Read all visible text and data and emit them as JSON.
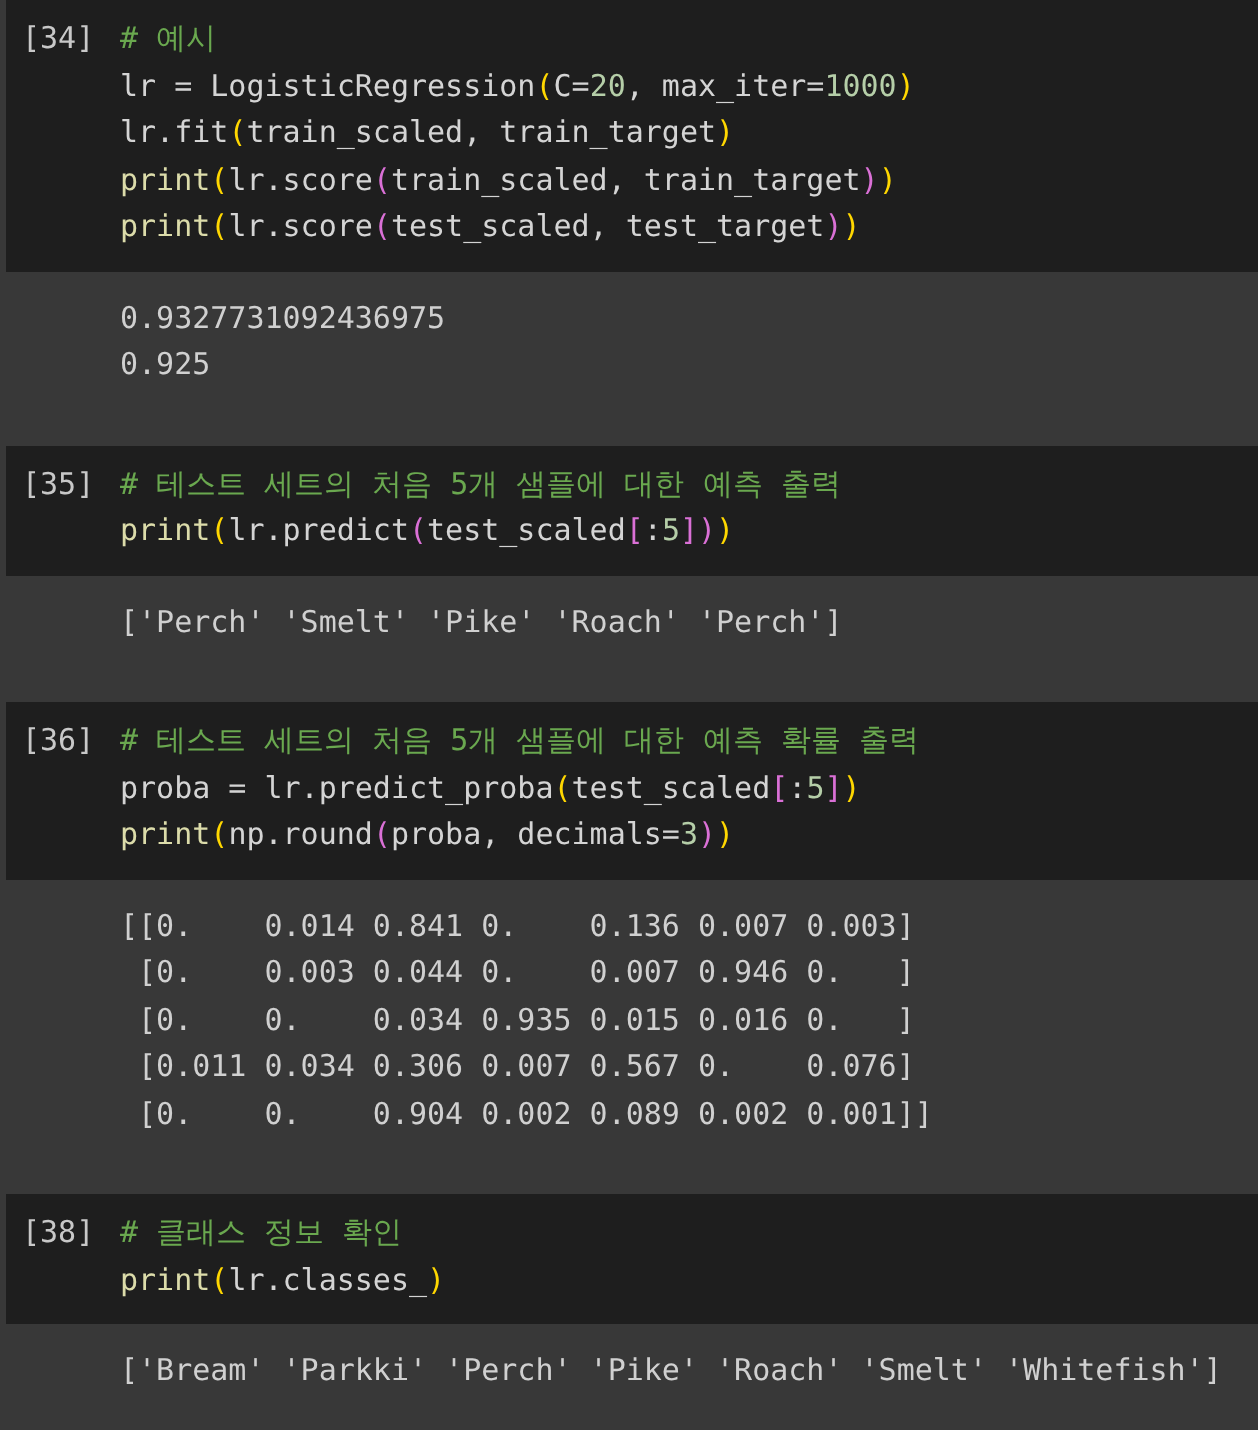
{
  "cells": [
    {
      "prompt": "[34]",
      "code": [
        [
          {
            "kind": "comment",
            "text": "# 예시"
          }
        ],
        [
          {
            "kind": "plain",
            "text": "lr = LogisticRegression"
          },
          {
            "kind": "paren1",
            "text": "("
          },
          {
            "kind": "plain",
            "text": "C="
          },
          {
            "kind": "number",
            "text": "20"
          },
          {
            "kind": "plain",
            "text": ", max_iter="
          },
          {
            "kind": "number",
            "text": "1000"
          },
          {
            "kind": "paren1",
            "text": ")"
          }
        ],
        [
          {
            "kind": "plain",
            "text": "lr.fit"
          },
          {
            "kind": "paren1",
            "text": "("
          },
          {
            "kind": "plain",
            "text": "train_scaled, train_target"
          },
          {
            "kind": "paren1",
            "text": ")"
          }
        ],
        [
          {
            "kind": "func",
            "text": "print"
          },
          {
            "kind": "paren1",
            "text": "("
          },
          {
            "kind": "plain",
            "text": "lr.score"
          },
          {
            "kind": "paren2",
            "text": "("
          },
          {
            "kind": "plain",
            "text": "train_scaled, train_target"
          },
          {
            "kind": "paren2",
            "text": ")"
          },
          {
            "kind": "paren1",
            "text": ")"
          }
        ],
        [
          {
            "kind": "func",
            "text": "print"
          },
          {
            "kind": "paren1",
            "text": "("
          },
          {
            "kind": "plain",
            "text": "lr.score"
          },
          {
            "kind": "paren2",
            "text": "("
          },
          {
            "kind": "plain",
            "text": "test_scaled, test_target"
          },
          {
            "kind": "paren2",
            "text": ")"
          },
          {
            "kind": "paren1",
            "text": ")"
          }
        ]
      ],
      "output": [
        "0.9327731092436975",
        "0.925"
      ]
    },
    {
      "prompt": "[35]",
      "code": [
        [
          {
            "kind": "comment",
            "text": "# 테스트 세트의 처음 5개 샘플에 대한 예측 출력"
          }
        ],
        [
          {
            "kind": "func",
            "text": "print"
          },
          {
            "kind": "paren1",
            "text": "("
          },
          {
            "kind": "plain",
            "text": "lr.predict"
          },
          {
            "kind": "paren2",
            "text": "("
          },
          {
            "kind": "plain",
            "text": "test_scaled"
          },
          {
            "kind": "paren3",
            "text": "["
          },
          {
            "kind": "plain",
            "text": ":"
          },
          {
            "kind": "number",
            "text": "5"
          },
          {
            "kind": "paren3",
            "text": "]"
          },
          {
            "kind": "paren2",
            "text": ")"
          },
          {
            "kind": "paren1",
            "text": ")"
          }
        ]
      ],
      "output": [
        "['Perch' 'Smelt' 'Pike' 'Roach' 'Perch']"
      ]
    },
    {
      "prompt": "[36]",
      "code": [
        [
          {
            "kind": "comment",
            "text": "# 테스트 세트의 처음 5개 샘플에 대한 예측 확률 출력"
          }
        ],
        [
          {
            "kind": "plain",
            "text": "proba = lr.predict_proba"
          },
          {
            "kind": "paren1",
            "text": "("
          },
          {
            "kind": "plain",
            "text": "test_scaled"
          },
          {
            "kind": "paren2",
            "text": "["
          },
          {
            "kind": "plain",
            "text": ":"
          },
          {
            "kind": "number",
            "text": "5"
          },
          {
            "kind": "paren2",
            "text": "]"
          },
          {
            "kind": "paren1",
            "text": ")"
          }
        ],
        [
          {
            "kind": "func",
            "text": "print"
          },
          {
            "kind": "paren1",
            "text": "("
          },
          {
            "kind": "plain",
            "text": "np.round"
          },
          {
            "kind": "paren2",
            "text": "("
          },
          {
            "kind": "plain",
            "text": "proba, decimals="
          },
          {
            "kind": "number",
            "text": "3"
          },
          {
            "kind": "paren2",
            "text": ")"
          },
          {
            "kind": "paren1",
            "text": ")"
          }
        ]
      ],
      "output": [
        "[[0.    0.014 0.841 0.    0.136 0.007 0.003]",
        " [0.    0.003 0.044 0.    0.007 0.946 0.   ]",
        " [0.    0.    0.034 0.935 0.015 0.016 0.   ]",
        " [0.011 0.034 0.306 0.007 0.567 0.    0.076]",
        " [0.    0.    0.904 0.002 0.089 0.002 0.001]]"
      ]
    },
    {
      "prompt": "[38]",
      "code": [
        [
          {
            "kind": "comment",
            "text": "# 클래스 정보 확인"
          }
        ],
        [
          {
            "kind": "func",
            "text": "print"
          },
          {
            "kind": "paren1",
            "text": "("
          },
          {
            "kind": "plain",
            "text": "lr.classes_"
          },
          {
            "kind": "paren1",
            "text": ")"
          }
        ]
      ],
      "output": [
        "['Bream' 'Parkki' 'Perch' 'Pike' 'Roach' 'Smelt' 'Whitefish']"
      ]
    }
  ]
}
